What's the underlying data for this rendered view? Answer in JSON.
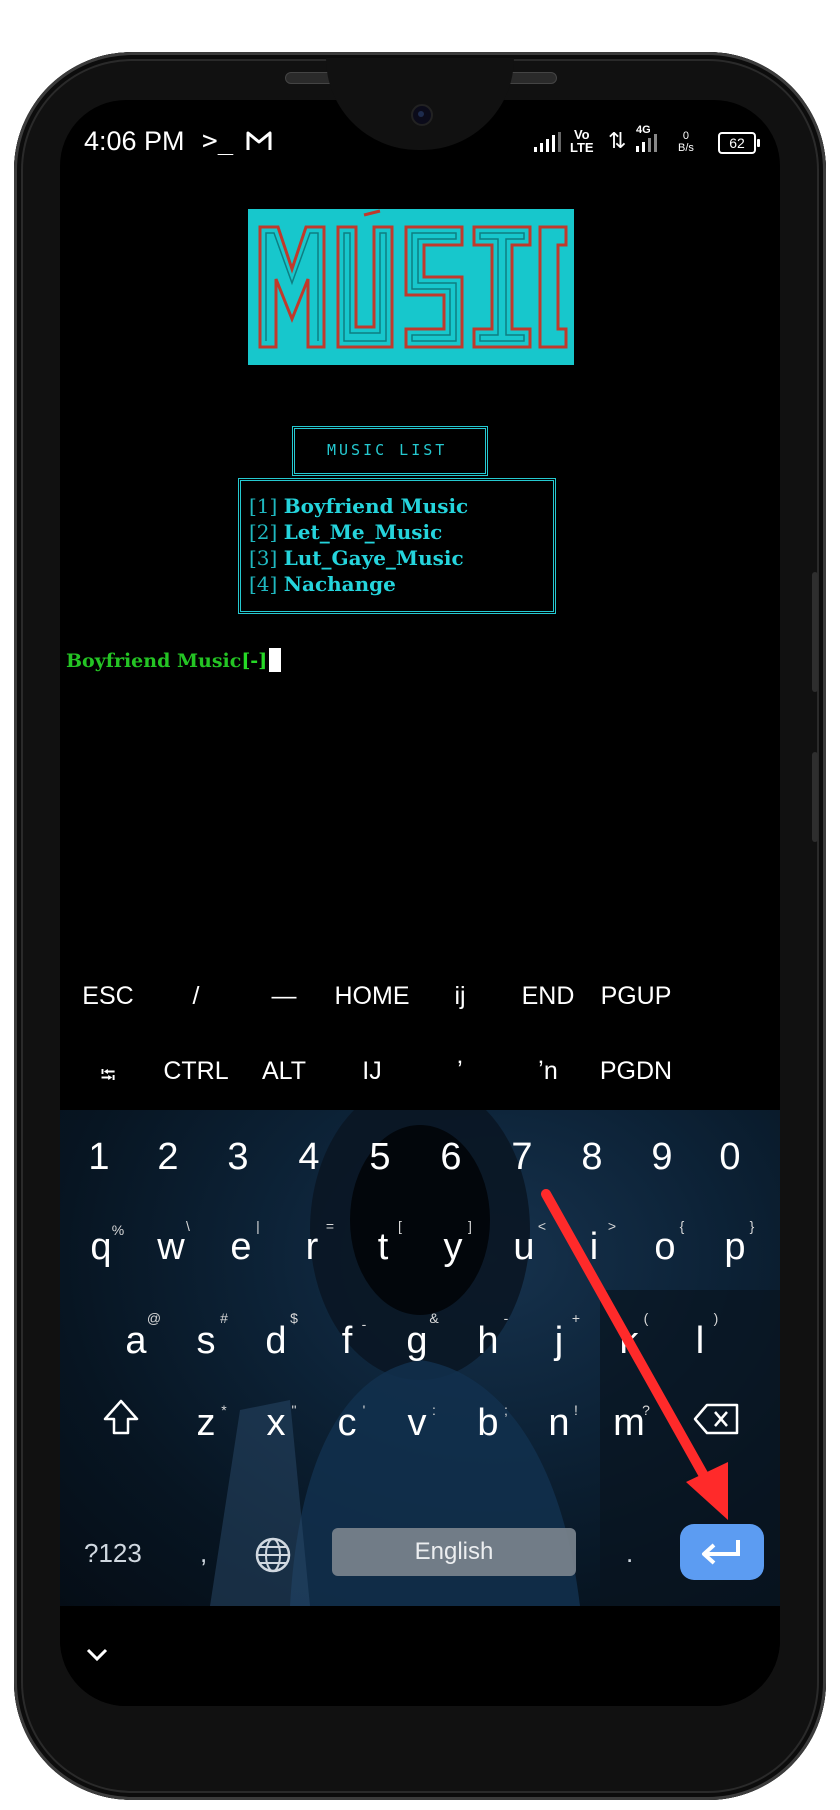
{
  "status_bar": {
    "time": "4:06 PM",
    "terminal_glyph": ">_",
    "mail_icon": "gmail-icon",
    "volte_top": "Vo",
    "volte_bottom": "LTE",
    "network": "4G",
    "speed_value": "0",
    "speed_unit": "B/s",
    "battery": "62"
  },
  "banner": {
    "text": "MUSIC"
  },
  "music_list": {
    "title": "MUSIC LIST",
    "items": [
      {
        "index": "[1]",
        "name": "Boyfriend Music"
      },
      {
        "index": "[2]",
        "name": "Let_Me_Music"
      },
      {
        "index": "[3]",
        "name": "Lut_Gaye_Music"
      },
      {
        "index": "[4]",
        "name": "Nachange"
      }
    ]
  },
  "prompt": {
    "text": "Boyfriend Music",
    "suffix": "[-]"
  },
  "extra_keys": {
    "row1": [
      "ESC",
      "/",
      "—",
      "HOME",
      "ij",
      "END",
      "PGUP"
    ],
    "row2": [
      "⭾",
      "CTRL",
      "ALT",
      "IJ",
      "ʼ",
      "ʼn",
      "PGDN"
    ]
  },
  "keyboard": {
    "numbers": [
      "1",
      "2",
      "3",
      "4",
      "5",
      "6",
      "7",
      "8",
      "9",
      "0"
    ],
    "row_q": [
      {
        "k": "q",
        "h": "%"
      },
      {
        "k": "w",
        "h": "\\"
      },
      {
        "k": "e",
        "h": "|"
      },
      {
        "k": "r",
        "h": "="
      },
      {
        "k": "t",
        "h": "["
      },
      {
        "k": "y",
        "h": "]"
      },
      {
        "k": "u",
        "h": "<"
      },
      {
        "k": "i",
        "h": ">"
      },
      {
        "k": "o",
        "h": "{"
      },
      {
        "k": "p",
        "h": "}"
      }
    ],
    "row_a": [
      {
        "k": "a",
        "h": "@"
      },
      {
        "k": "s",
        "h": "#"
      },
      {
        "k": "d",
        "h": "$"
      },
      {
        "k": "f",
        "h": "-"
      },
      {
        "k": "g",
        "h": "&"
      },
      {
        "k": "h",
        "h": "-"
      },
      {
        "k": "j",
        "h": "+"
      },
      {
        "k": "k",
        "h": "("
      },
      {
        "k": "l",
        "h": ")"
      }
    ],
    "row_z": [
      {
        "k": "z",
        "h": "*"
      },
      {
        "k": "x",
        "h": "\""
      },
      {
        "k": "c",
        "h": "'"
      },
      {
        "k": "v",
        "h": ":"
      },
      {
        "k": "b",
        "h": ";"
      },
      {
        "k": "n",
        "h": "!"
      },
      {
        "k": "m",
        "h": "?"
      }
    ],
    "symbols_key": "?123",
    "comma_key": ",",
    "space_label": "English",
    "period_key": ".",
    "shift_icon": "shift-icon",
    "backspace_icon": "backspace-icon",
    "globe_icon": "globe-icon",
    "enter_icon": "enter-icon"
  },
  "annotation": {
    "arrow_color": "#ff2a2a"
  },
  "colors": {
    "accent_cyan": "#25c9d0",
    "prompt_green": "#24c424",
    "enter_blue": "#5c9cf2"
  }
}
